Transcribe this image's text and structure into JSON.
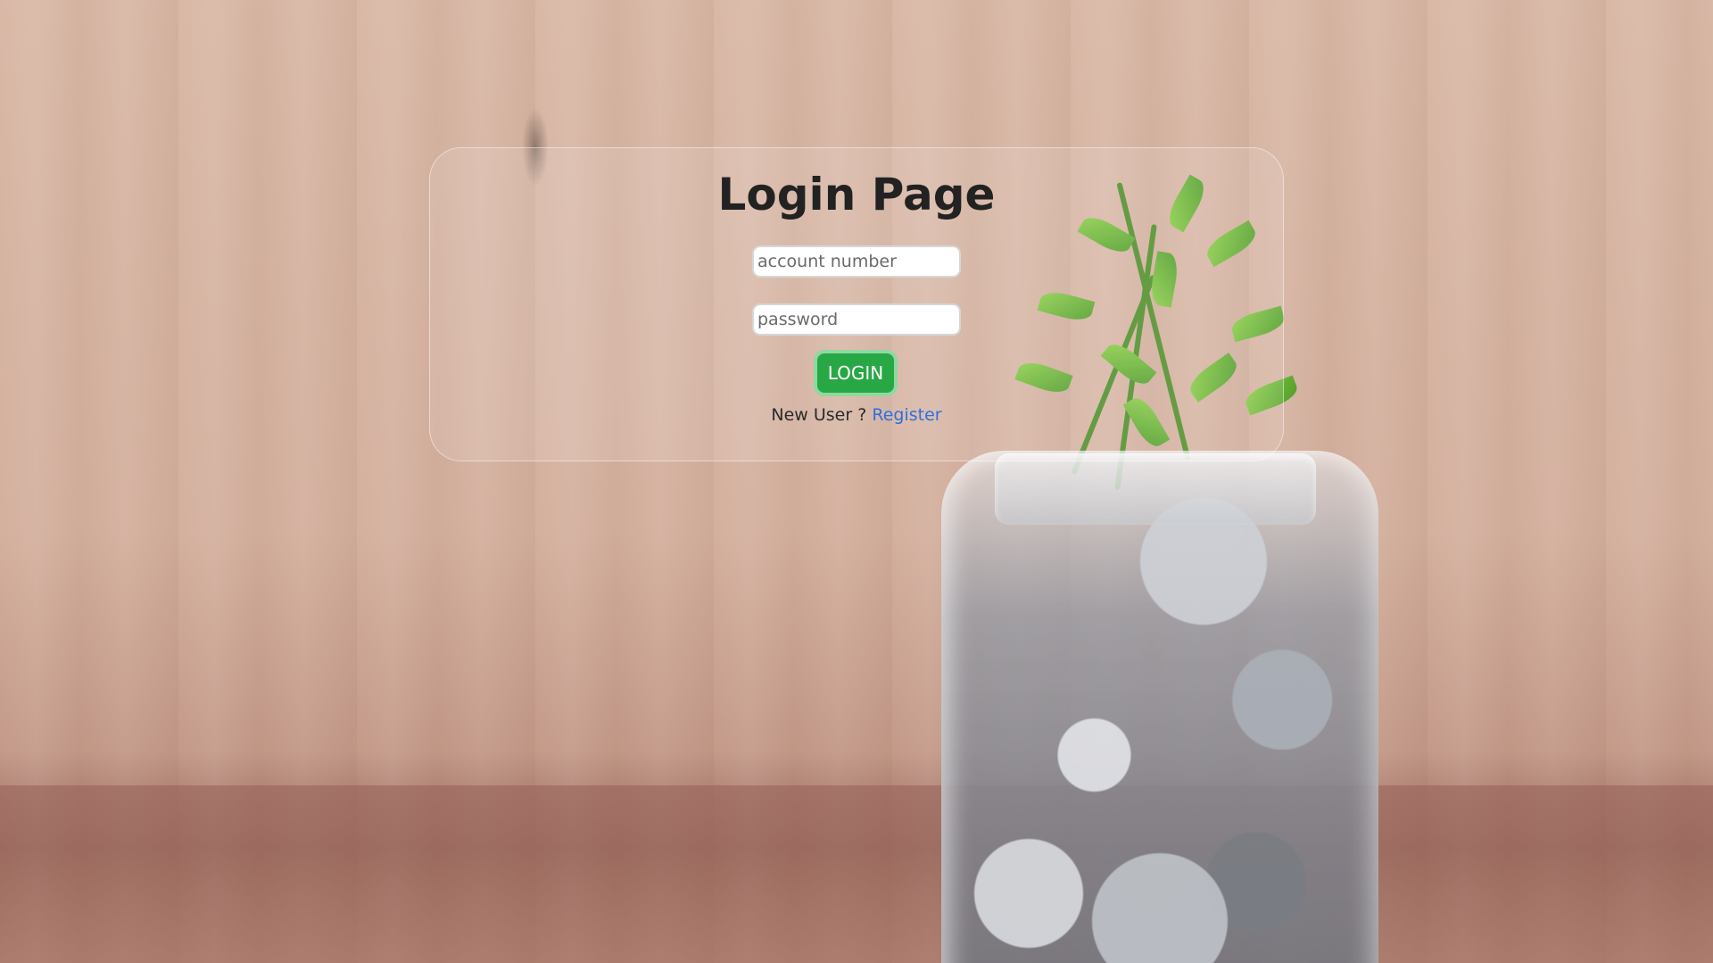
{
  "login": {
    "title": "Login Page",
    "account_placeholder": "account number",
    "password_placeholder": "password",
    "login_label": "LOGIN",
    "new_user_text": "New User ?",
    "register_label": "Register"
  },
  "colors": {
    "button": "#28a745",
    "link": "#2f6fde"
  }
}
